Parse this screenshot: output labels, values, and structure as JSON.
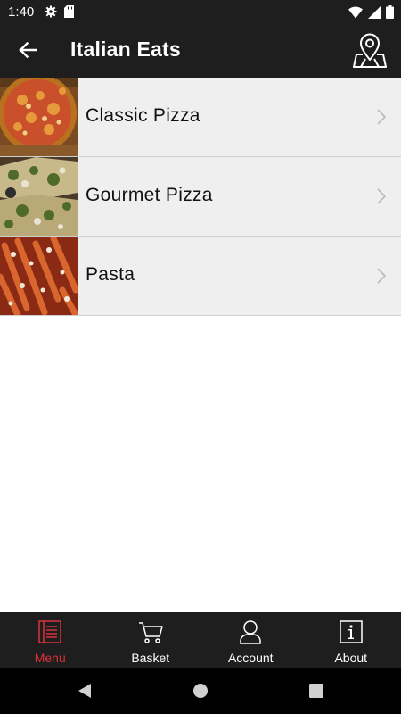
{
  "status_bar": {
    "time": "1:40",
    "left_icons": [
      "gear-icon",
      "sd-card-icon"
    ],
    "right_icons": [
      "wifi-icon",
      "cell-signal-icon",
      "battery-icon"
    ]
  },
  "app_bar": {
    "title": "Italian Eats",
    "back_icon": "arrow-left-icon",
    "action_icon": "map-location-icon"
  },
  "menu": {
    "items": [
      {
        "label": "Classic Pizza",
        "image": "classic-pizza-photo"
      },
      {
        "label": "Gourmet Pizza",
        "image": "gourmet-pizza-photo"
      },
      {
        "label": "Pasta",
        "image": "pasta-photo"
      }
    ]
  },
  "bottom_nav": {
    "items": [
      {
        "label": "Menu",
        "icon": "menu-book-icon",
        "active": true
      },
      {
        "label": "Basket",
        "icon": "cart-icon",
        "active": false
      },
      {
        "label": "Account",
        "icon": "person-icon",
        "active": false
      },
      {
        "label": "About",
        "icon": "info-icon",
        "active": false
      }
    ]
  },
  "colors": {
    "bar_background": "#1e1e1e",
    "row_background": "#efefef",
    "active_accent": "#d9303c",
    "text_light": "#ffffff"
  }
}
